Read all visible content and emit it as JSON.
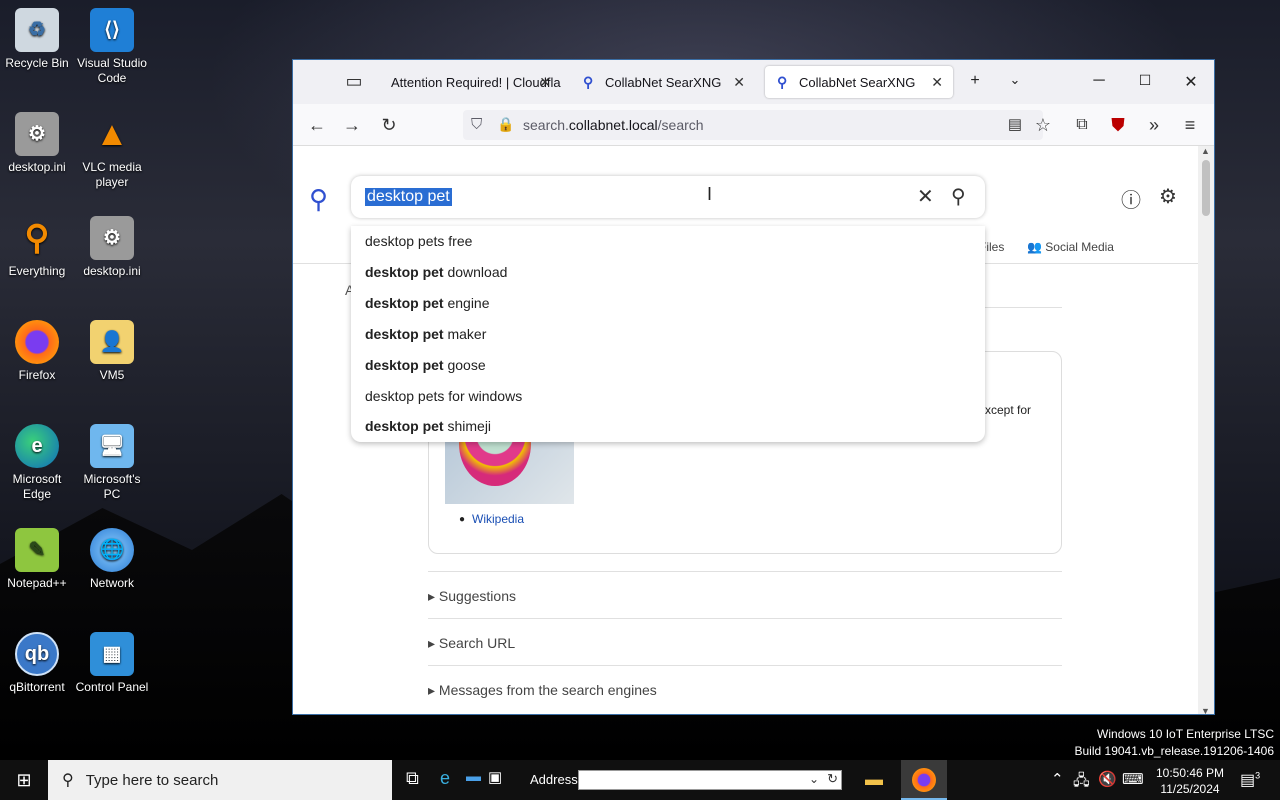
{
  "desktop": {
    "icons": [
      {
        "label": "Recycle Bin"
      },
      {
        "label": "Visual Studio Code"
      },
      {
        "label": "desktop.ini"
      },
      {
        "label": "VLC media player"
      },
      {
        "label": "Everything"
      },
      {
        "label": "desktop.ini"
      },
      {
        "label": "Firefox"
      },
      {
        "label": "VM5"
      },
      {
        "label": "Microsoft Edge"
      },
      {
        "label": "Microsoft's PC"
      },
      {
        "label": "Notepad++"
      },
      {
        "label": "Network"
      },
      {
        "label": "qBittorrent"
      },
      {
        "label": "Control Panel"
      }
    ],
    "watermark_line1": "Windows 10 IoT Enterprise LTSC",
    "watermark_line2": "Build 19041.vb_release.191206-1406"
  },
  "browser": {
    "tabs": [
      {
        "label": "Attention Required! | Cloudfla",
        "active": false
      },
      {
        "label": "CollabNet SearXNG",
        "active": false
      },
      {
        "label": "CollabNet SearXNG",
        "active": true
      }
    ],
    "url_prefix": "search.",
    "url_domain": "collabnet.local",
    "url_path": "/search",
    "page": {
      "search_value": "desktop pet",
      "suggestions": [
        {
          "bold": "",
          "rest": "desktop pets free"
        },
        {
          "bold": "desktop pet",
          "rest": " download"
        },
        {
          "bold": "desktop pet",
          "rest": " engine"
        },
        {
          "bold": "desktop pet",
          "rest": " maker"
        },
        {
          "bold": "desktop pet",
          "rest": " goose"
        },
        {
          "bold": "",
          "rest": "desktop pets for windows"
        },
        {
          "bold": "desktop pet",
          "rest": " shimeji"
        }
      ],
      "categories": {
        "files": "Files",
        "social_media": "Social Media"
      },
      "partial_letter": "A",
      "infobox_text": "xcept for",
      "wiki_link": "Wikipedia",
      "sections": [
        "Suggestions",
        "Search URL",
        "Messages from the search engines"
      ]
    }
  },
  "taskbar": {
    "search_placeholder": "Type here to search",
    "address_label": "Address",
    "time": "10:50:46 PM",
    "date": "11/25/2024",
    "notification_count": "3"
  }
}
